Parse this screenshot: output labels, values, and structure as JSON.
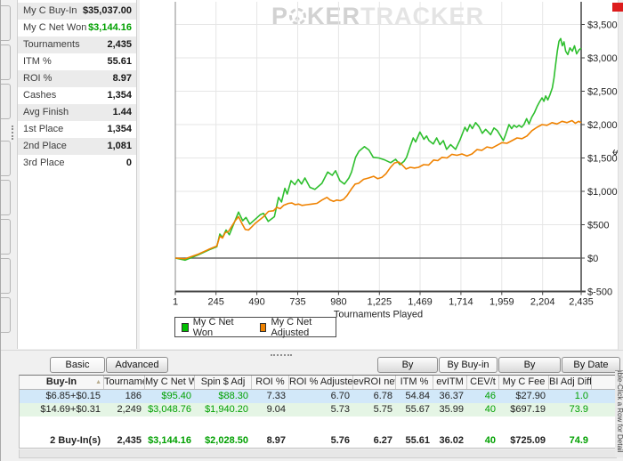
{
  "sidebar": {
    "stats": [
      {
        "label": "My C Buy-In",
        "value": "$35,037.00",
        "green": false
      },
      {
        "label": "My C Net Won",
        "value": "$3,144.16",
        "green": true
      },
      {
        "label": "Tournaments",
        "value": "2,435",
        "green": false
      },
      {
        "label": "ITM %",
        "value": "55.61",
        "green": false
      },
      {
        "label": "ROI %",
        "value": "8.97",
        "green": false
      },
      {
        "label": "Cashes",
        "value": "1,354",
        "green": false
      },
      {
        "label": "Avg Finish",
        "value": "1.44",
        "green": false
      },
      {
        "label": "1st Place",
        "value": "1,354",
        "green": false
      },
      {
        "label": "2nd Place",
        "value": "1,081",
        "green": false
      },
      {
        "label": "3rd Place",
        "value": "0",
        "green": false
      }
    ]
  },
  "chart": {
    "watermark_p": "P",
    "watermark_chip_glyph": "♠",
    "watermark_ker": "KER",
    "watermark_tracker": "TRACKER"
  },
  "chart_data": {
    "type": "line",
    "title": "",
    "xlabel": "Tournaments Played",
    "ylabel": "$",
    "xlim": [
      1,
      2435
    ],
    "ylim": [
      -500,
      3500
    ],
    "grid": true,
    "legend_position": "bottom-left",
    "x_ticks": [
      {
        "v": 1,
        "label": "1"
      },
      {
        "v": 245,
        "label": "245"
      },
      {
        "v": 490,
        "label": "490"
      },
      {
        "v": 735,
        "label": "735"
      },
      {
        "v": 980,
        "label": "980"
      },
      {
        "v": 1225,
        "label": "1,225"
      },
      {
        "v": 1469,
        "label": "1,469"
      },
      {
        "v": 1714,
        "label": "1,714"
      },
      {
        "v": 1959,
        "label": "1,959"
      },
      {
        "v": 2204,
        "label": "2,204"
      },
      {
        "v": 2435,
        "label": "2,435"
      }
    ],
    "y_ticks": [
      {
        "v": 3500,
        "label": "$3,500"
      },
      {
        "v": 3000,
        "label": "$3,000"
      },
      {
        "v": 2500,
        "label": "$2,500"
      },
      {
        "v": 2000,
        "label": "$2,000"
      },
      {
        "v": 1500,
        "label": "$1,500"
      },
      {
        "v": 1000,
        "label": "$1,000"
      },
      {
        "v": 500,
        "label": "$500"
      },
      {
        "v": 0,
        "label": "$0"
      },
      {
        "v": -500,
        "label": "$-500"
      }
    ],
    "series": [
      {
        "name": "My C Net Won",
        "color": "#2ebf2e",
        "final_value": 3144.16,
        "points": [
          [
            1,
            0
          ],
          [
            60,
            -30
          ],
          [
            140,
            50
          ],
          [
            200,
            120
          ],
          [
            250,
            170
          ],
          [
            268,
            360
          ],
          [
            284,
            310
          ],
          [
            305,
            420
          ],
          [
            325,
            350
          ],
          [
            380,
            690
          ],
          [
            405,
            560
          ],
          [
            425,
            610
          ],
          [
            448,
            510
          ],
          [
            510,
            650
          ],
          [
            530,
            670
          ],
          [
            558,
            550
          ],
          [
            595,
            620
          ],
          [
            620,
            910
          ],
          [
            638,
            840
          ],
          [
            658,
            1045
          ],
          [
            672,
            960
          ],
          [
            695,
            1160
          ],
          [
            718,
            1100
          ],
          [
            738,
            1180
          ],
          [
            758,
            1110
          ],
          [
            778,
            1200
          ],
          [
            808,
            1060
          ],
          [
            838,
            1030
          ],
          [
            880,
            1120
          ],
          [
            915,
            1290
          ],
          [
            942,
            1240
          ],
          [
            962,
            1310
          ],
          [
            988,
            1160
          ],
          [
            1015,
            1110
          ],
          [
            1042,
            1200
          ],
          [
            1058,
            1290
          ],
          [
            1082,
            1510
          ],
          [
            1102,
            1600
          ],
          [
            1135,
            1670
          ],
          [
            1162,
            1620
          ],
          [
            1188,
            1510
          ],
          [
            1222,
            1500
          ],
          [
            1258,
            1470
          ],
          [
            1292,
            1430
          ],
          [
            1322,
            1480
          ],
          [
            1348,
            1400
          ],
          [
            1372,
            1450
          ],
          [
            1388,
            1510
          ],
          [
            1412,
            1690
          ],
          [
            1428,
            1800
          ],
          [
            1442,
            1740
          ],
          [
            1468,
            1890
          ],
          [
            1492,
            1780
          ],
          [
            1508,
            1830
          ],
          [
            1522,
            1760
          ],
          [
            1548,
            1710
          ],
          [
            1568,
            1800
          ],
          [
            1588,
            1700
          ],
          [
            1608,
            1760
          ],
          [
            1628,
            1630
          ],
          [
            1652,
            1700
          ],
          [
            1682,
            1630
          ],
          [
            1708,
            1770
          ],
          [
            1738,
            1960
          ],
          [
            1752,
            1900
          ],
          [
            1768,
            2000
          ],
          [
            1782,
            1940
          ],
          [
            1802,
            2030
          ],
          [
            1822,
            1970
          ],
          [
            1842,
            1870
          ],
          [
            1862,
            1930
          ],
          [
            1892,
            1850
          ],
          [
            1912,
            1950
          ],
          [
            1932,
            1910
          ],
          [
            1952,
            1830
          ],
          [
            1968,
            1760
          ],
          [
            1982,
            1850
          ],
          [
            2002,
            2000
          ],
          [
            2018,
            1940
          ],
          [
            2032,
            1990
          ],
          [
            2048,
            1960
          ],
          [
            2062,
            1990
          ],
          [
            2078,
            1960
          ],
          [
            2092,
            2000
          ],
          [
            2108,
            2090
          ],
          [
            2122,
            2010
          ],
          [
            2138,
            2110
          ],
          [
            2155,
            2180
          ],
          [
            2170,
            2270
          ],
          [
            2185,
            2340
          ],
          [
            2200,
            2400
          ],
          [
            2212,
            2350
          ],
          [
            2222,
            2430
          ],
          [
            2235,
            2370
          ],
          [
            2248,
            2450
          ],
          [
            2262,
            2550
          ],
          [
            2272,
            2700
          ],
          [
            2282,
            2900
          ],
          [
            2292,
            3100
          ],
          [
            2302,
            3250
          ],
          [
            2312,
            3290
          ],
          [
            2322,
            3180
          ],
          [
            2332,
            3240
          ],
          [
            2342,
            3100
          ],
          [
            2355,
            3050
          ],
          [
            2368,
            3150
          ],
          [
            2382,
            3100
          ],
          [
            2395,
            3180
          ],
          [
            2408,
            3060
          ],
          [
            2422,
            3120
          ],
          [
            2435,
            3144
          ]
        ]
      },
      {
        "name": "My C Net Adjusted",
        "color": "#ef8200",
        "final_value": 2028.5,
        "points": [
          [
            1,
            0
          ],
          [
            60,
            -10
          ],
          [
            140,
            60
          ],
          [
            200,
            130
          ],
          [
            250,
            180
          ],
          [
            268,
            330
          ],
          [
            284,
            300
          ],
          [
            300,
            380
          ],
          [
            320,
            400
          ],
          [
            360,
            560
          ],
          [
            380,
            620
          ],
          [
            400,
            520
          ],
          [
            420,
            430
          ],
          [
            440,
            420
          ],
          [
            460,
            470
          ],
          [
            480,
            520
          ],
          [
            500,
            560
          ],
          [
            530,
            620
          ],
          [
            560,
            700
          ],
          [
            590,
            710
          ],
          [
            610,
            760
          ],
          [
            630,
            740
          ],
          [
            650,
            790
          ],
          [
            680,
            820
          ],
          [
            700,
            825
          ],
          [
            720,
            800
          ],
          [
            740,
            810
          ],
          [
            760,
            790
          ],
          [
            790,
            800
          ],
          [
            820,
            810
          ],
          [
            850,
            820
          ],
          [
            880,
            870
          ],
          [
            910,
            910
          ],
          [
            930,
            870
          ],
          [
            950,
            850
          ],
          [
            970,
            870
          ],
          [
            990,
            860
          ],
          [
            1010,
            880
          ],
          [
            1030,
            935
          ],
          [
            1060,
            1045
          ],
          [
            1080,
            1110
          ],
          [
            1100,
            1120
          ],
          [
            1130,
            1180
          ],
          [
            1160,
            1200
          ],
          [
            1190,
            1225
          ],
          [
            1215,
            1190
          ],
          [
            1240,
            1210
          ],
          [
            1265,
            1265
          ],
          [
            1290,
            1355
          ],
          [
            1315,
            1425
          ],
          [
            1340,
            1440
          ],
          [
            1360,
            1400
          ],
          [
            1385,
            1335
          ],
          [
            1410,
            1360
          ],
          [
            1435,
            1350
          ],
          [
            1460,
            1360
          ],
          [
            1490,
            1400
          ],
          [
            1520,
            1395
          ],
          [
            1550,
            1470
          ],
          [
            1575,
            1460
          ],
          [
            1600,
            1510
          ],
          [
            1630,
            1500
          ],
          [
            1660,
            1555
          ],
          [
            1690,
            1540
          ],
          [
            1720,
            1560
          ],
          [
            1750,
            1530
          ],
          [
            1780,
            1560
          ],
          [
            1810,
            1625
          ],
          [
            1840,
            1615
          ],
          [
            1870,
            1665
          ],
          [
            1900,
            1650
          ],
          [
            1930,
            1690
          ],
          [
            1960,
            1730
          ],
          [
            1990,
            1720
          ],
          [
            2020,
            1760
          ],
          [
            2050,
            1800
          ],
          [
            2080,
            1790
          ],
          [
            2110,
            1830
          ],
          [
            2140,
            1910
          ],
          [
            2170,
            1960
          ],
          [
            2200,
            2000
          ],
          [
            2230,
            1990
          ],
          [
            2260,
            2030
          ],
          [
            2290,
            2010
          ],
          [
            2320,
            2050
          ],
          [
            2350,
            2030
          ],
          [
            2380,
            2060
          ],
          [
            2400,
            2020
          ],
          [
            2420,
            2050
          ],
          [
            2435,
            2028.5
          ]
        ]
      }
    ]
  },
  "bottom": {
    "tabs": [
      {
        "label": "Basic",
        "active": true
      },
      {
        "label": "Advanced",
        "active": false
      }
    ],
    "view_buttons": [
      {
        "label": "By Description",
        "active": false
      },
      {
        "label": "By Buy-in",
        "active": true
      },
      {
        "label": "By Tournament",
        "active": false
      },
      {
        "label": "By Date",
        "active": false
      }
    ],
    "side_note": "Double-Click a Row for Detail"
  },
  "table": {
    "columns": [
      "Buy-In",
      "Tournaments",
      "My C Net Won",
      "Spin $ Adj",
      "ROI %",
      "ROI % Adjusted",
      "evROI new",
      "ITM %",
      "evITM",
      "CEV/t",
      "My C Fee",
      "BI Adj Diff"
    ],
    "sort_column": "Buy-In",
    "sort_direction": "asc",
    "positive_color": "#00a000",
    "green_columns": [
      2,
      3,
      9,
      11
    ],
    "rows": [
      {
        "bg": "selected",
        "cells": [
          "$6.85+$0.15",
          "186",
          "$95.40",
          "$88.30",
          "7.33",
          "6.70",
          "6.78",
          "54.84",
          "36.37",
          "46",
          "$27.90",
          "1.0"
        ]
      },
      {
        "bg": "greenbg",
        "cells": [
          "$14.69+$0.31",
          "2,249",
          "$3,048.76",
          "$1,940.20",
          "9.04",
          "5.73",
          "5.75",
          "55.67",
          "35.99",
          "40",
          "$697.19",
          "73.9"
        ]
      }
    ],
    "summary": [
      "2 Buy-In(s)",
      "2,435",
      "$3,144.16",
      "$2,028.50",
      "8.97",
      "5.76",
      "6.27",
      "55.61",
      "36.02",
      "40",
      "$725.09",
      "74.9"
    ]
  }
}
